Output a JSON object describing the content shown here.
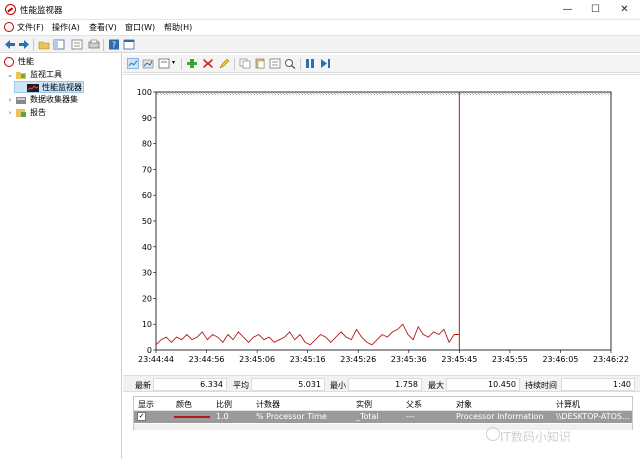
{
  "window": {
    "title": "性能监视器",
    "minimize": "—",
    "maximize": "☐",
    "close": "✕"
  },
  "menu": [
    "文件(F)",
    "操作(A)",
    "查看(V)",
    "窗口(W)",
    "帮助(H)"
  ],
  "sidebar": {
    "root": "性能",
    "items": [
      {
        "label": "监视工具",
        "expanded": true
      },
      {
        "label": "性能监视器",
        "selected": true
      },
      {
        "label": "数据收集器集",
        "expanded": false
      },
      {
        "label": "报告",
        "expanded": false
      }
    ]
  },
  "chart_data": {
    "type": "line",
    "ylim": [
      0,
      100
    ],
    "yticks": [
      "100",
      "90",
      "80",
      "70",
      "60",
      "50",
      "40",
      "30",
      "20",
      "10",
      "0"
    ],
    "xticks": [
      "23:44:44",
      "23:44:56",
      "23:45:06",
      "23:45:16",
      "23:45:26",
      "23:45:36",
      "23:45:45",
      "23:45:55",
      "23:46:05",
      "23:46:22"
    ],
    "series": [
      {
        "color": "#b31b1b",
        "values": [
          2,
          4,
          5,
          3,
          5,
          4,
          6,
          4,
          5,
          7,
          4,
          6,
          5,
          3,
          6,
          4,
          7,
          5,
          3,
          5,
          6,
          4,
          5,
          3,
          4,
          5,
          7,
          4,
          6,
          3,
          2,
          4,
          6,
          5,
          3,
          5,
          7,
          5,
          4,
          8,
          5,
          3,
          2,
          4,
          6,
          5,
          7,
          8,
          10,
          6,
          4,
          9,
          6,
          5,
          7,
          6,
          8,
          3,
          6,
          6
        ]
      }
    ],
    "grid": false
  },
  "stats": {
    "last_label": "最新",
    "last": "6.334",
    "avg_label": "平均",
    "avg": "5.031",
    "min_label": "最小",
    "min": "1.758",
    "max_label": "最大",
    "max": "10.450",
    "duration_label": "持续时间",
    "duration": "1:40"
  },
  "counter_table": {
    "headers": [
      "显示",
      "颜色",
      "比例",
      "计数器",
      "实例",
      "父系",
      "对象",
      "计算机"
    ],
    "row": {
      "checked": "✓",
      "color": "#b31b1b",
      "scale": "1.0",
      "counter": "% Processor Time",
      "instance": "_Total",
      "parent": "---",
      "object": "Processor Information",
      "computer": "\\\\DESKTOP-ATOS..."
    }
  },
  "watermark": "IT数码小知识"
}
